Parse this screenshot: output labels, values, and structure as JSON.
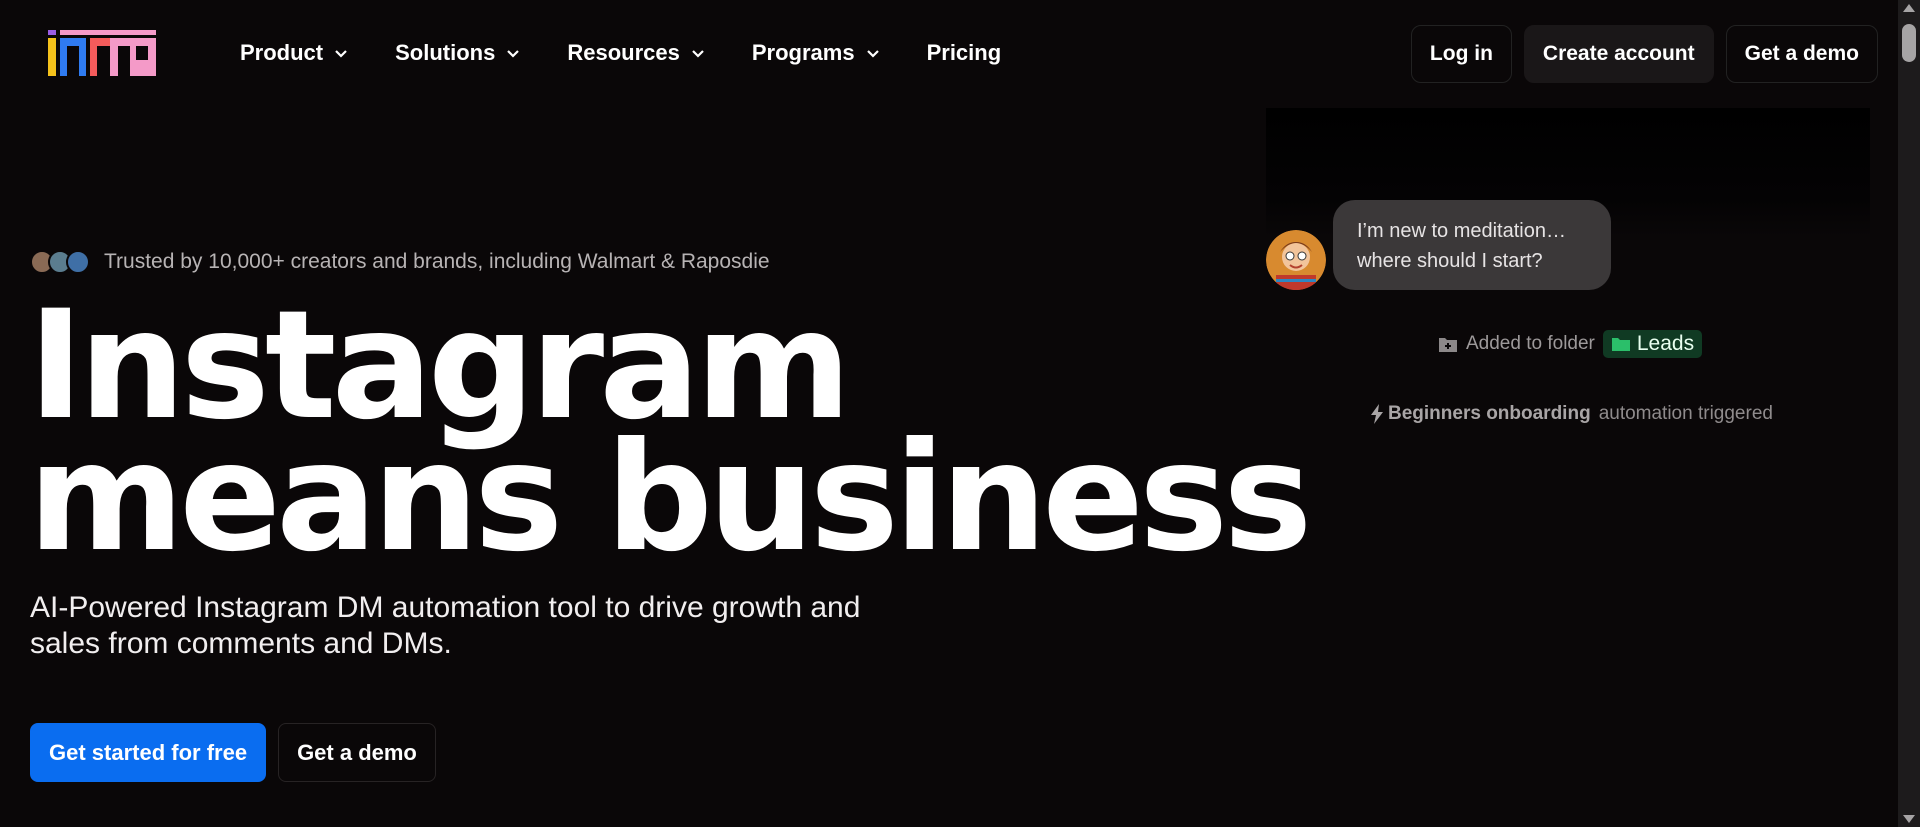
{
  "brand": {
    "logo_text": "inrr",
    "colors": {
      "yellow": "#f5c21b",
      "blue": "#2f7bf1",
      "pink": "#f49ac8",
      "purple": "#9b5de5"
    }
  },
  "nav": {
    "items": [
      {
        "label": "Product",
        "has_dropdown": true
      },
      {
        "label": "Solutions",
        "has_dropdown": true
      },
      {
        "label": "Resources",
        "has_dropdown": true
      },
      {
        "label": "Programs",
        "has_dropdown": true
      },
      {
        "label": "Pricing",
        "has_dropdown": false
      }
    ],
    "login_label": "Log in",
    "create_account_label": "Create account",
    "demo_label": "Get a demo"
  },
  "hero": {
    "trusted_text": "Trusted by 10,000+ creators and brands, including Walmart & Raposdie",
    "headline_line1": "Instagram",
    "headline_line2": "means business",
    "subhead": "AI-Powered Instagram DM automation tool to drive growth and sales from comments and DMs.",
    "cta_primary": "Get started for free",
    "cta_secondary": "Get a demo",
    "accent_color": "#0a6df0"
  },
  "demo_panel": {
    "message_line1": "I’m new to meditation…",
    "message_line2": "where should I start?",
    "folder_prefix": "Added to folder",
    "folder_name": "Leads",
    "automation_name": "Beginners onboarding",
    "automation_suffix": "automation triggered",
    "folder_chip_color": "#103a23"
  }
}
